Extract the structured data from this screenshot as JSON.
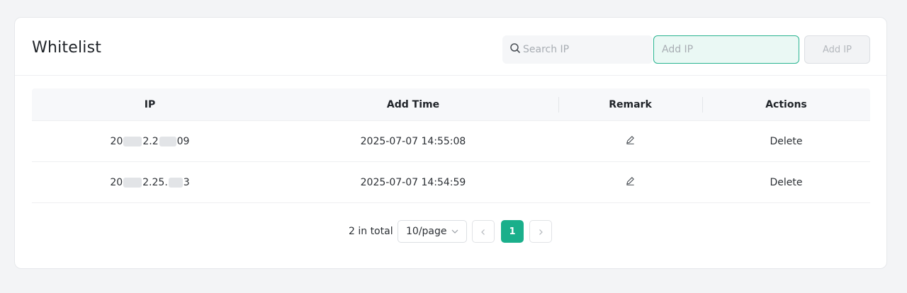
{
  "header": {
    "title": "Whitelist",
    "search_placeholder": "Search IP",
    "add_placeholder": "Add IP",
    "add_button": "Add IP"
  },
  "table": {
    "columns": [
      "IP",
      "Add Time",
      "Remark",
      "Actions"
    ],
    "rows": [
      {
        "ip_a": "20",
        "ip_b": "2.2",
        "ip_c": "09",
        "time": "2025-07-07 14:55:08",
        "action": "Delete"
      },
      {
        "ip_a": "20",
        "ip_b": "2.25.",
        "ip_c": "3",
        "time": "2025-07-07 14:54:59",
        "action": "Delete"
      }
    ]
  },
  "pagination": {
    "total": "2 in total",
    "page_size": "10/page",
    "current_page": "1"
  },
  "icons": [
    "search-icon",
    "pencil-icon",
    "chevron-down-icon",
    "chevron-left-icon",
    "chevron-right-icon"
  ],
  "colors": {
    "accent": "#1aaf8b",
    "input_focus_bg": "#eaf8f4"
  }
}
